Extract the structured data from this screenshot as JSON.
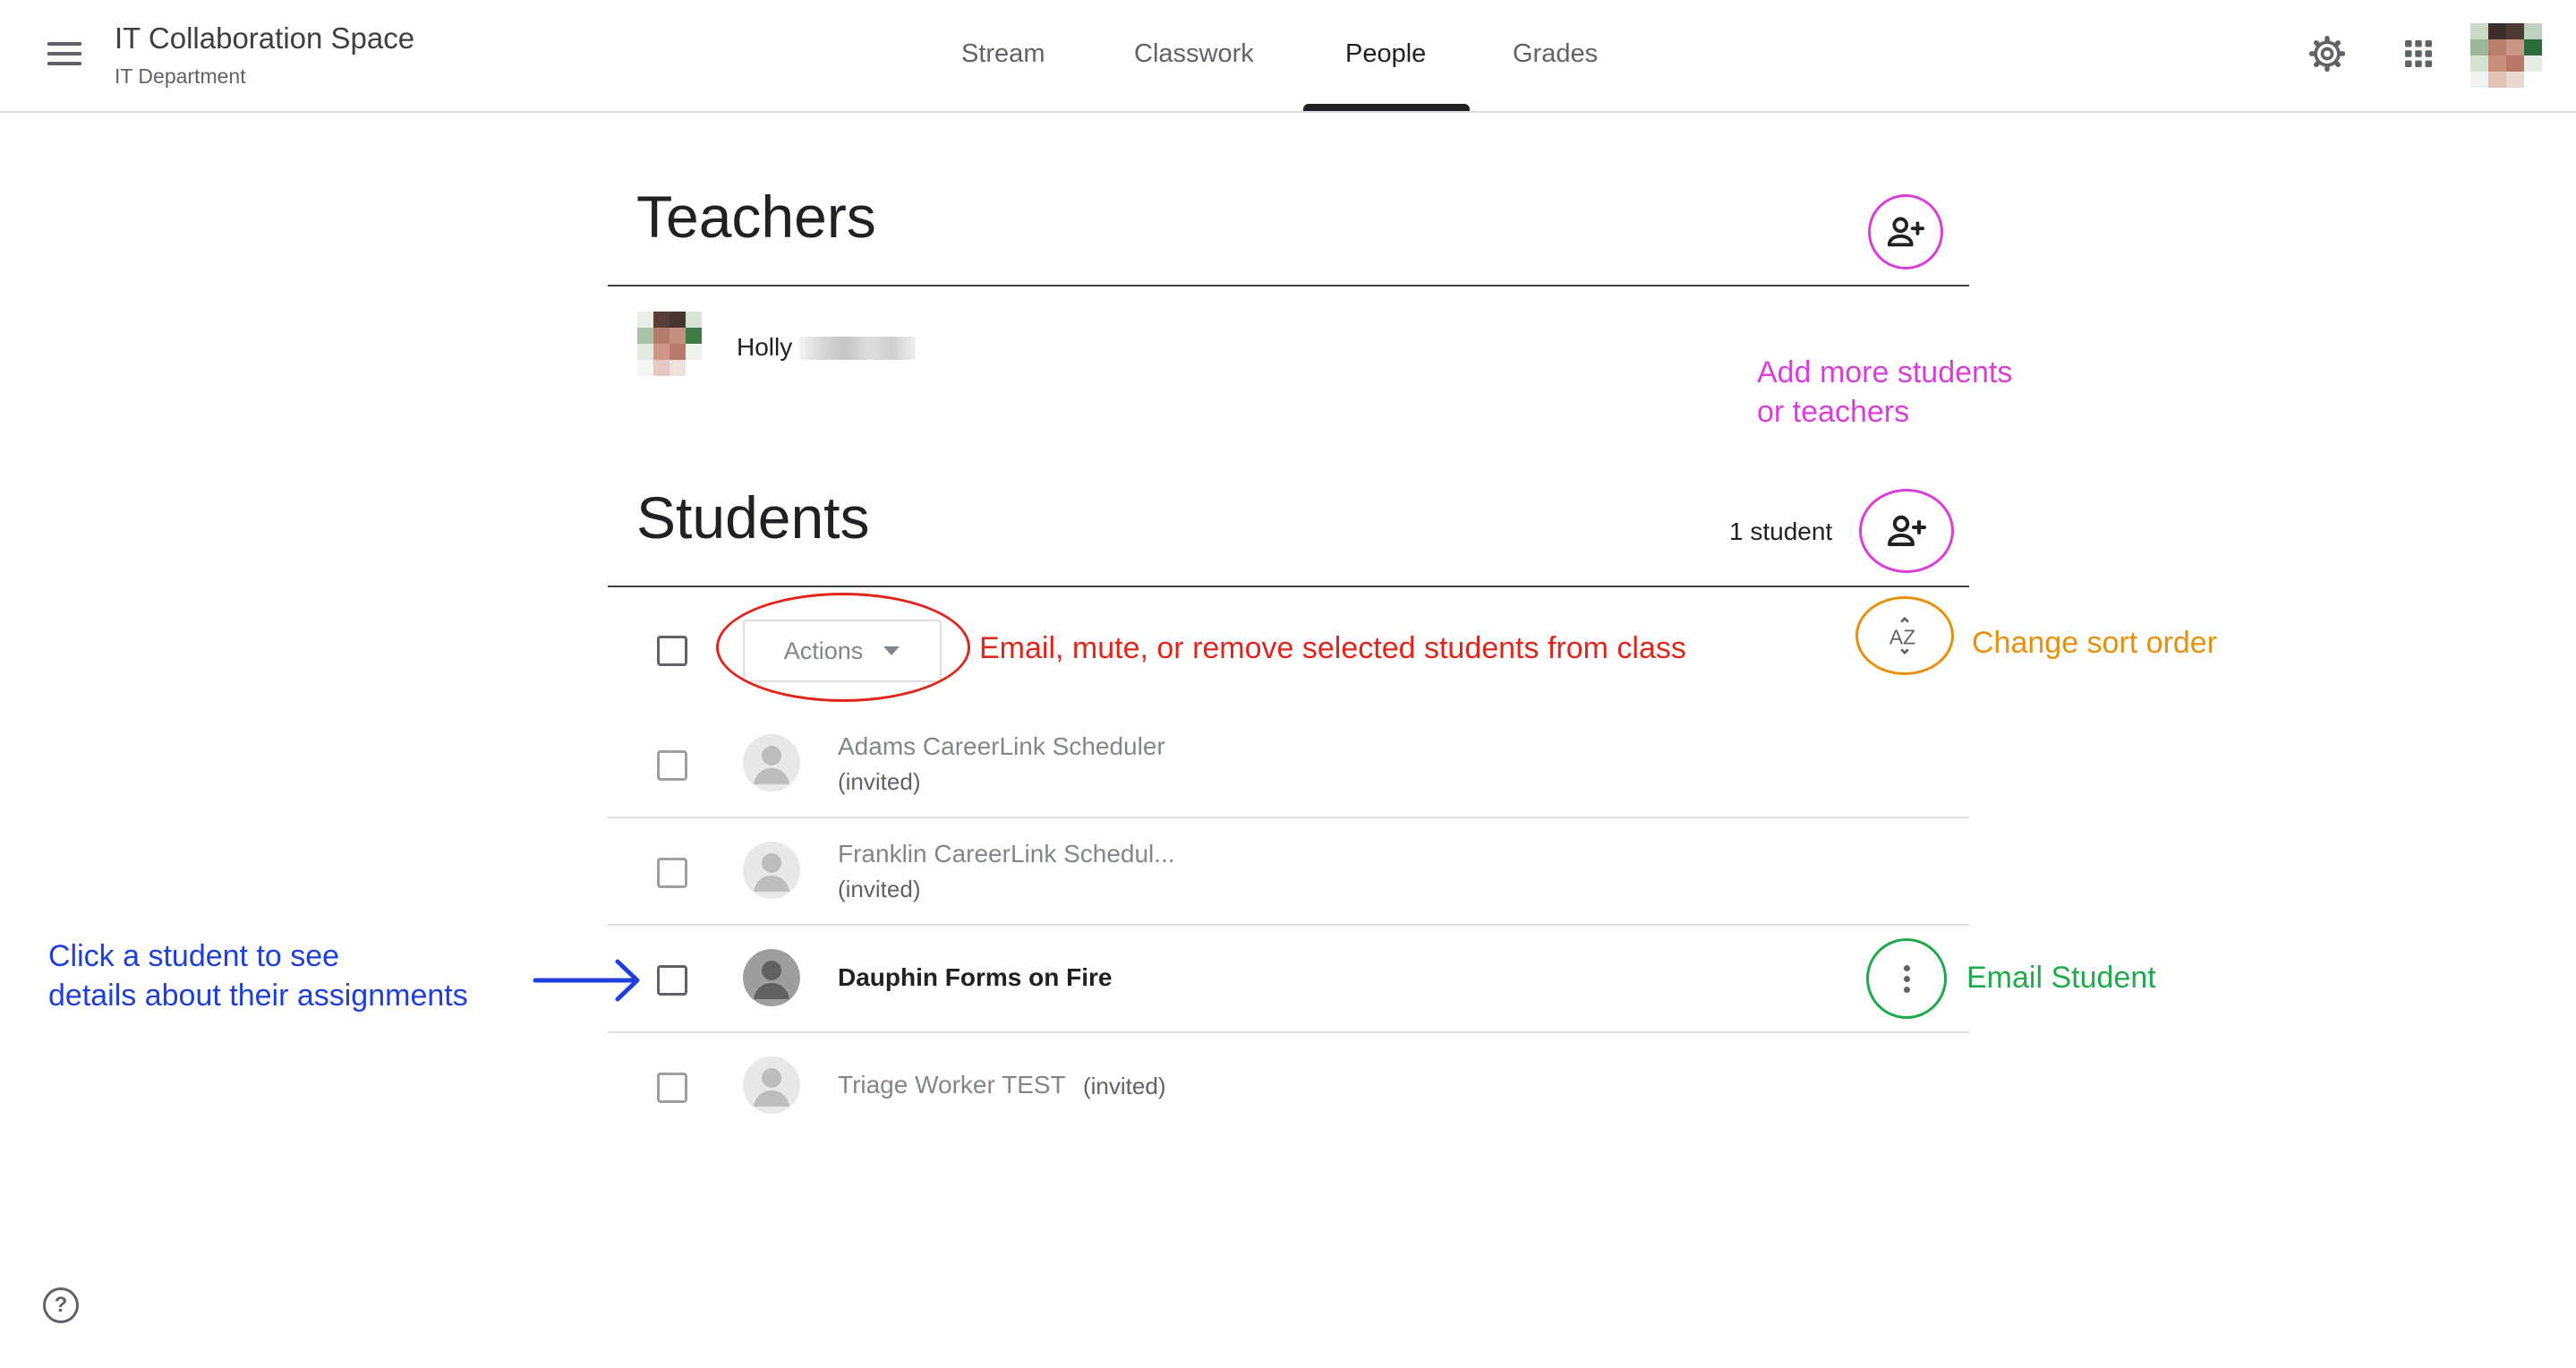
{
  "header": {
    "class_title": "IT Collaboration Space",
    "class_subtitle": "IT Department",
    "tabs": [
      {
        "label": "Stream"
      },
      {
        "label": "Classwork"
      },
      {
        "label": "People"
      },
      {
        "label": "Grades"
      }
    ],
    "active_tab": "People",
    "icons": [
      "menu-icon",
      "settings-gear-icon",
      "apps-grid-icon",
      "account-avatar"
    ]
  },
  "teachers": {
    "title": "Teachers",
    "items": [
      {
        "name": "Holly"
      }
    ]
  },
  "students": {
    "title": "Students",
    "count_label": "1 student",
    "actions_label": "Actions",
    "items": [
      {
        "name": "Adams CareerLink Scheduler",
        "status": "(invited)"
      },
      {
        "name": "Franklin CareerLink Schedul...",
        "status": "(invited)"
      },
      {
        "name": "Dauphin Forms on Fire",
        "status": ""
      },
      {
        "name": "Triage Worker TEST",
        "status": "(invited)"
      }
    ]
  },
  "annotations": {
    "add_people": [
      "Add more students",
      "or teachers"
    ],
    "actions_hint": "Email, mute, or remove  selected students from class",
    "sort_hint": "Change sort order",
    "student_hint": [
      "Click a student to see",
      "details about their assignments"
    ],
    "email_hint": "Email Student"
  },
  "colors": {
    "magenta": "#d93ed9",
    "red": "#e0261c",
    "orange": "#e8900c",
    "green": "#1faa4b",
    "blue": "#1f3fdc"
  }
}
